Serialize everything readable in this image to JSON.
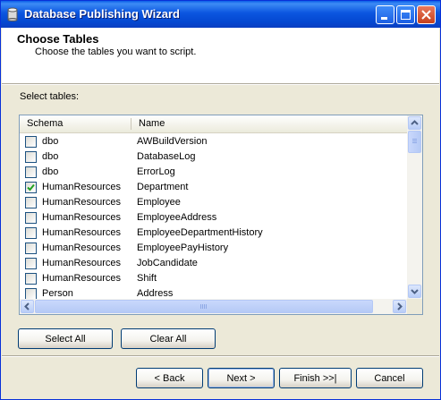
{
  "window": {
    "title": "Database Publishing Wizard",
    "controls": [
      "minimize-icon",
      "maximize-icon",
      "close-icon"
    ]
  },
  "header": {
    "title": "Choose Tables",
    "subtitle": "Choose the tables you want to script."
  },
  "tables": {
    "label": "Select tables:",
    "columns": [
      "Schema",
      "Name"
    ],
    "rows": [
      {
        "schema": "dbo",
        "name": "AWBuildVersion",
        "checked": false
      },
      {
        "schema": "dbo",
        "name": "DatabaseLog",
        "checked": false
      },
      {
        "schema": "dbo",
        "name": "ErrorLog",
        "checked": false
      },
      {
        "schema": "HumanResources",
        "name": "Department",
        "checked": true
      },
      {
        "schema": "HumanResources",
        "name": "Employee",
        "checked": false
      },
      {
        "schema": "HumanResources",
        "name": "EmployeeAddress",
        "checked": false
      },
      {
        "schema": "HumanResources",
        "name": "EmployeeDepartmentHistory",
        "checked": false
      },
      {
        "schema": "HumanResources",
        "name": "EmployeePayHistory",
        "checked": false
      },
      {
        "schema": "HumanResources",
        "name": "JobCandidate",
        "checked": false
      },
      {
        "schema": "HumanResources",
        "name": "Shift",
        "checked": false
      },
      {
        "schema": "Person",
        "name": "Address",
        "checked": false
      }
    ]
  },
  "selection": {
    "select_all": "Select All",
    "clear_all": "Clear All"
  },
  "footer": {
    "back": "< Back",
    "next": "Next >",
    "finish": "Finish >>|",
    "cancel": "Cancel"
  },
  "colors": {
    "titlebar": "#0b55e0",
    "dialog_bg": "#ece9d8",
    "check": "#21a121"
  }
}
